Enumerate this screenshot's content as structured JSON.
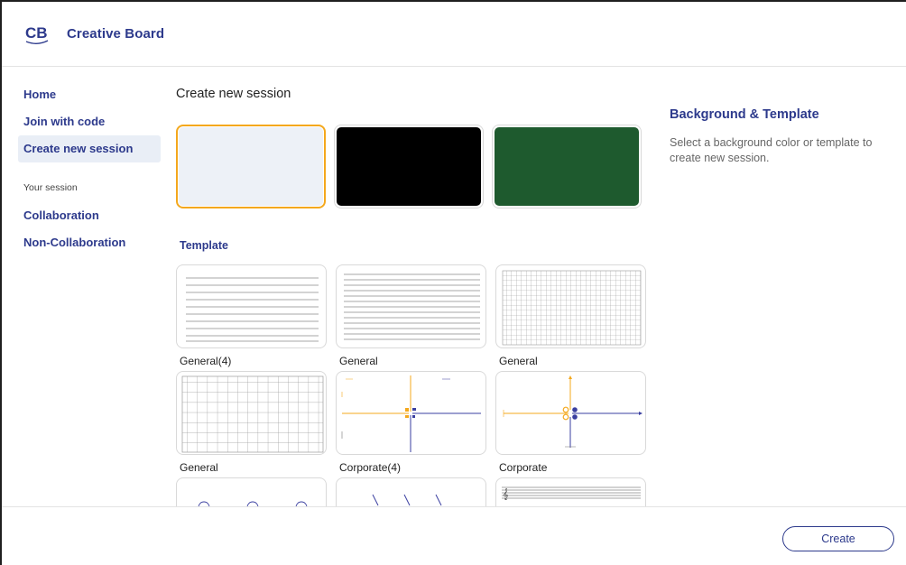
{
  "app": {
    "logo_text": "CB",
    "title": "Creative Board"
  },
  "sidebar": {
    "items": [
      {
        "label": "Home"
      },
      {
        "label": "Join with code"
      },
      {
        "label": "Create new session",
        "active": true
      }
    ],
    "section_label": "Your session",
    "session_items": [
      {
        "label": "Collaboration"
      },
      {
        "label": "Non-Collaboration"
      }
    ]
  },
  "main": {
    "title": "Create new session",
    "backgrounds": [
      {
        "color": "#edf1f7",
        "selected": true
      },
      {
        "color": "#000000",
        "selected": false
      },
      {
        "color": "#1e5a2e",
        "selected": false
      }
    ],
    "template_label": "Template",
    "templates": [
      {
        "name": "General(4)",
        "icon": "lined-4-template"
      },
      {
        "name": "General",
        "icon": "lined-template"
      },
      {
        "name": "General",
        "icon": "fine-grid-template"
      },
      {
        "name": "General",
        "icon": "coarse-grid-template"
      },
      {
        "name": "Corporate(4)",
        "icon": "quadrant-4-template"
      },
      {
        "name": "Corporate",
        "icon": "quadrant-template"
      },
      {
        "name": "",
        "icon": "circles-template"
      },
      {
        "name": "",
        "icon": "slanted-lines-template"
      },
      {
        "name": "",
        "icon": "music-staff-template"
      }
    ]
  },
  "panel": {
    "title": "Background & Template",
    "description": "Select a background color or template to create new session."
  },
  "footer": {
    "create_label": "Create"
  },
  "colors": {
    "brand": "#2d3a8c",
    "selected_border": "#f4a81d",
    "accent_orange": "#f4a81d",
    "accent_blue": "#3a3fa0"
  }
}
